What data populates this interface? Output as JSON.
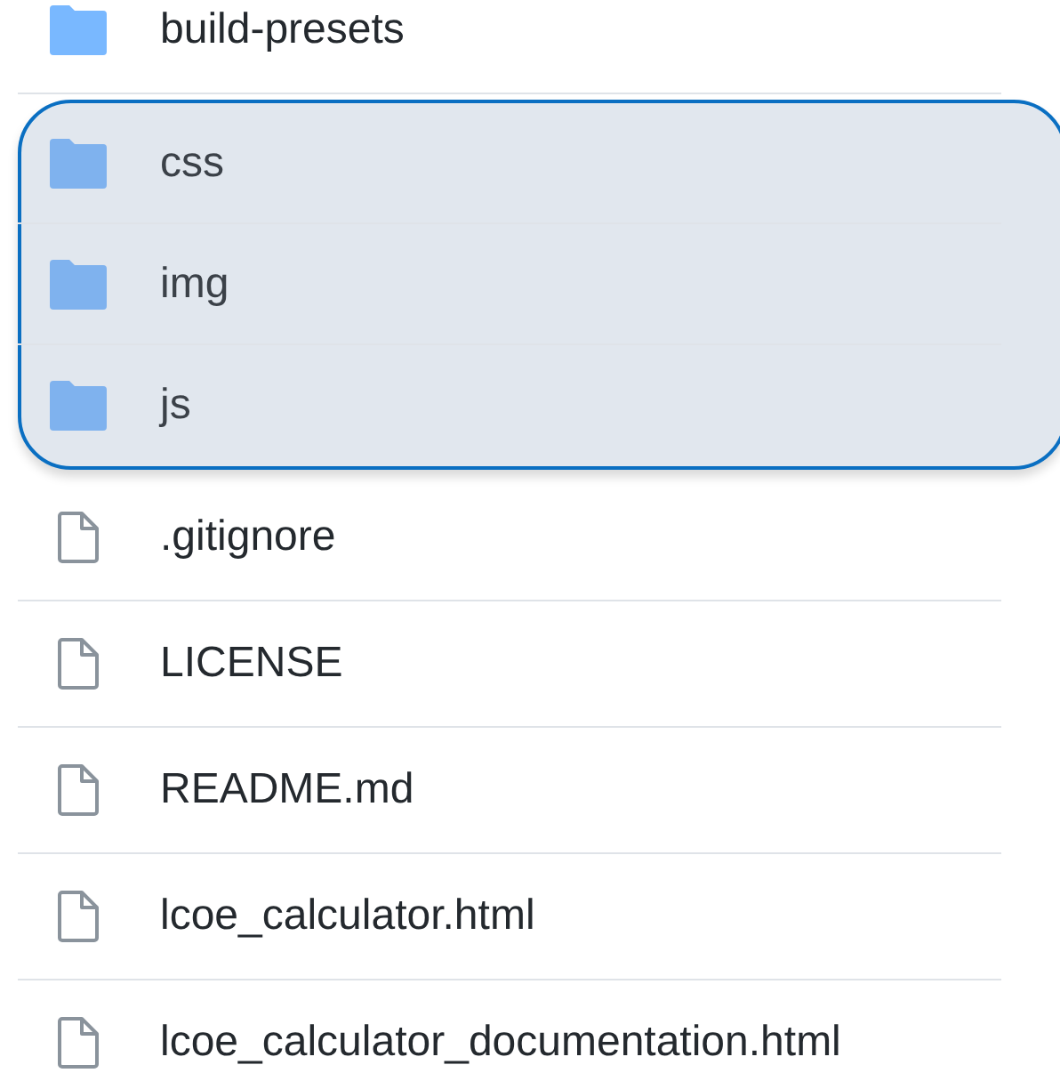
{
  "files": [
    {
      "kind": "folder",
      "name": "build-presets",
      "selected": false
    },
    {
      "kind": "folder",
      "name": "css",
      "selected": true
    },
    {
      "kind": "folder",
      "name": "img",
      "selected": true
    },
    {
      "kind": "folder",
      "name": "js",
      "selected": true
    },
    {
      "kind": "file",
      "name": ".gitignore",
      "selected": false
    },
    {
      "kind": "file",
      "name": "LICENSE",
      "selected": false
    },
    {
      "kind": "file",
      "name": "README.md",
      "selected": false
    },
    {
      "kind": "file",
      "name": "lcoe_calculator.html",
      "selected": false
    },
    {
      "kind": "file",
      "name": "lcoe_calculator_documentation.html",
      "selected": false
    }
  ]
}
